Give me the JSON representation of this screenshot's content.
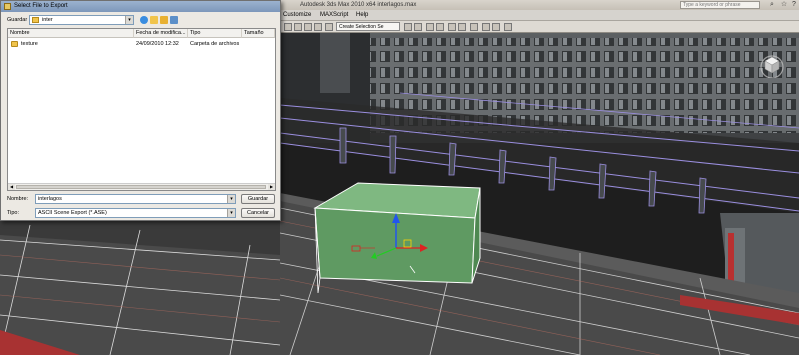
{
  "max": {
    "title": "Autodesk 3ds Max 2010 x64    interlagos.max",
    "search_placeholder": "Type a keyword or phrase",
    "menu": [
      "Customize",
      "MAXScript",
      "Help"
    ],
    "selection_set_placeholder": "Create Selection Se"
  },
  "dialog": {
    "title": "Select File to Export",
    "look_in_label": "Guardar",
    "look_in_value": "inter",
    "columns": [
      "Nombre",
      "Fecha de modifica...",
      "Tipo",
      "Tamaño"
    ],
    "files": [
      {
        "name": "texture",
        "date": "24/09/2010 12:32",
        "type": "Carpeta de archivos",
        "size": ""
      }
    ],
    "filename_label": "Nombre:",
    "filename_value": "interlagos",
    "filetype_label": "Tipo:",
    "filetype_value": "ASCII Scene Export (*.ASE)",
    "save_button": "Guardar",
    "cancel_button": "Cancelar"
  },
  "colors": {
    "dialog_title_bar": "#8aa3c4",
    "box_fill": "#5f9a62",
    "wire_color": "#9b8fe0",
    "gizmo_y": "#2255ee",
    "gizmo_x": "#dd2222",
    "gizmo_z": "#22cc22"
  }
}
